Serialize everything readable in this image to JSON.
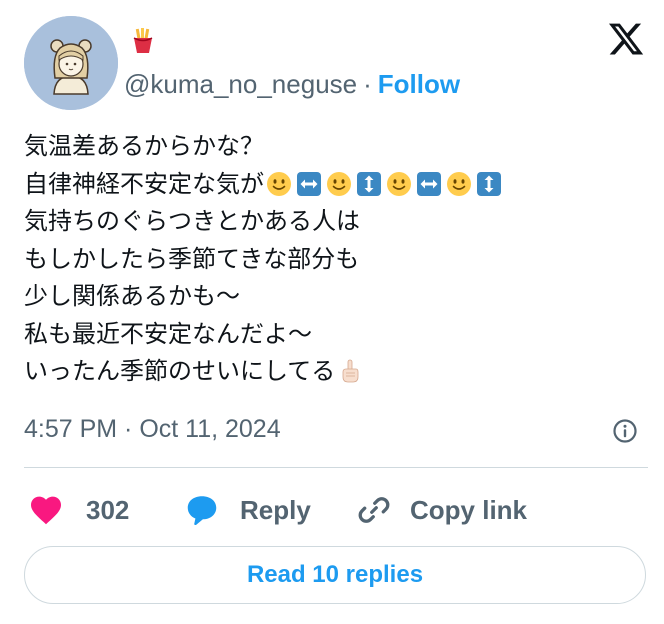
{
  "author": {
    "handle": "@kuma_no_neguse",
    "separator": "·",
    "follow_label": "Follow",
    "display_name_icon": "french-fries-emoji",
    "avatar": "bear-girl-illustration"
  },
  "tweet": {
    "lines": [
      {
        "text": "気温差あるからかな？"
      },
      {
        "text": "自律神経不安定な気が",
        "emojis": [
          "slightly-smiling-face",
          "left-right-arrow",
          "slightly-smiling-face",
          "up-down-arrow",
          "slightly-smiling-face",
          "left-right-arrow",
          "slightly-smiling-face",
          "up-down-arrow"
        ]
      },
      {
        "text": "気持ちのぐらつきとかある人は"
      },
      {
        "text": "もしかしたら季節てきな部分も"
      },
      {
        "text": "少し関係あるかも〜"
      },
      {
        "text": "私も最近不安定なんだよ〜"
      },
      {
        "text": "いったん季節のせいにしてる",
        "emojis": [
          "index-pointing-up-light-skin"
        ]
      }
    ],
    "timestamp": "4:57 PM · Oct 11, 2024"
  },
  "actions": {
    "like_count": "302",
    "reply_label": "Reply",
    "copy_link_label": "Copy link",
    "read_replies_label": "Read 10 replies"
  },
  "colors": {
    "accent": "#1d9bf0",
    "like": "#f91880",
    "secondary_text": "#536471",
    "border": "#cfd9de"
  }
}
